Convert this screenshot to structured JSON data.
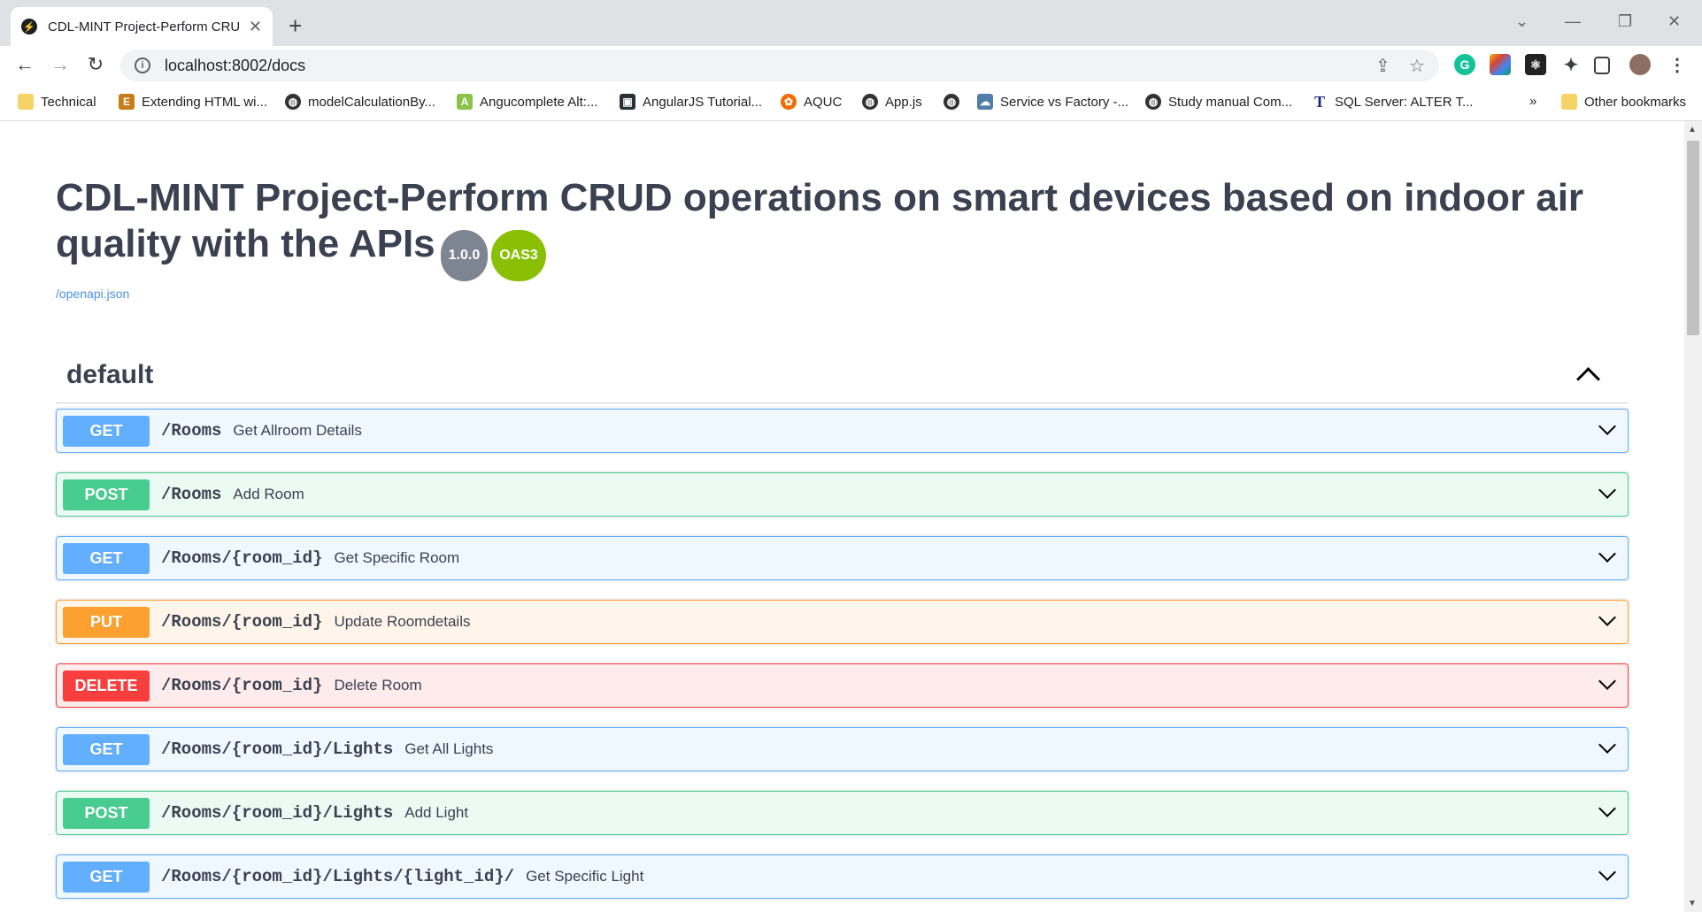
{
  "browser": {
    "tab_title": "CDL-MINT Project-Perform CRUD",
    "url": "localhost:8002/docs",
    "bookmarks": [
      {
        "label": "Technical",
        "icon": "folder-icon"
      },
      {
        "label": "Extending HTML wi...",
        "icon": "site-icon"
      },
      {
        "label": "modelCalculationBy...",
        "icon": "globe-icon"
      },
      {
        "label": "Angucomplete Alt:...",
        "icon": "site-icon"
      },
      {
        "label": "AngularJS Tutorial...",
        "icon": "site-icon"
      },
      {
        "label": "AQUC",
        "icon": "site-icon"
      },
      {
        "label": "App.js",
        "icon": "globe-icon"
      },
      {
        "label": "",
        "icon": "globe-icon"
      },
      {
        "label": "Service vs Factory -...",
        "icon": "site-icon"
      },
      {
        "label": "Study manual Com...",
        "icon": "globe-icon"
      },
      {
        "label": "SQL Server: ALTER T...",
        "icon": "site-icon"
      }
    ],
    "more_bookmarks": "»",
    "other_bookmarks": "Other bookmarks"
  },
  "info": {
    "title": "CDL-MINT Project-Perform CRUD operations on smart devices based on indoor air quality with the APIs",
    "version": "1.0.0",
    "oas": "OAS3",
    "spec_link": "/openapi.json"
  },
  "section": {
    "name": "default",
    "operations": [
      {
        "method": "GET",
        "path": "/Rooms",
        "summary": "Get Allroom Details"
      },
      {
        "method": "POST",
        "path": "/Rooms",
        "summary": "Add Room"
      },
      {
        "method": "GET",
        "path": "/Rooms/{room_id}",
        "summary": "Get Specific Room"
      },
      {
        "method": "PUT",
        "path": "/Rooms/{room_id}",
        "summary": "Update Roomdetails"
      },
      {
        "method": "DELETE",
        "path": "/Rooms/{room_id}",
        "summary": "Delete Room"
      },
      {
        "method": "GET",
        "path": "/Rooms/{room_id}/Lights",
        "summary": "Get All Lights"
      },
      {
        "method": "POST",
        "path": "/Rooms/{room_id}/Lights",
        "summary": "Add Light"
      },
      {
        "method": "GET",
        "path": "/Rooms/{room_id}/Lights/{light_id}/",
        "summary": "Get Specific Light"
      }
    ]
  },
  "colors": {
    "get": "#61affe",
    "post": "#49cc90",
    "put": "#fca130",
    "delete": "#f93e3e"
  }
}
